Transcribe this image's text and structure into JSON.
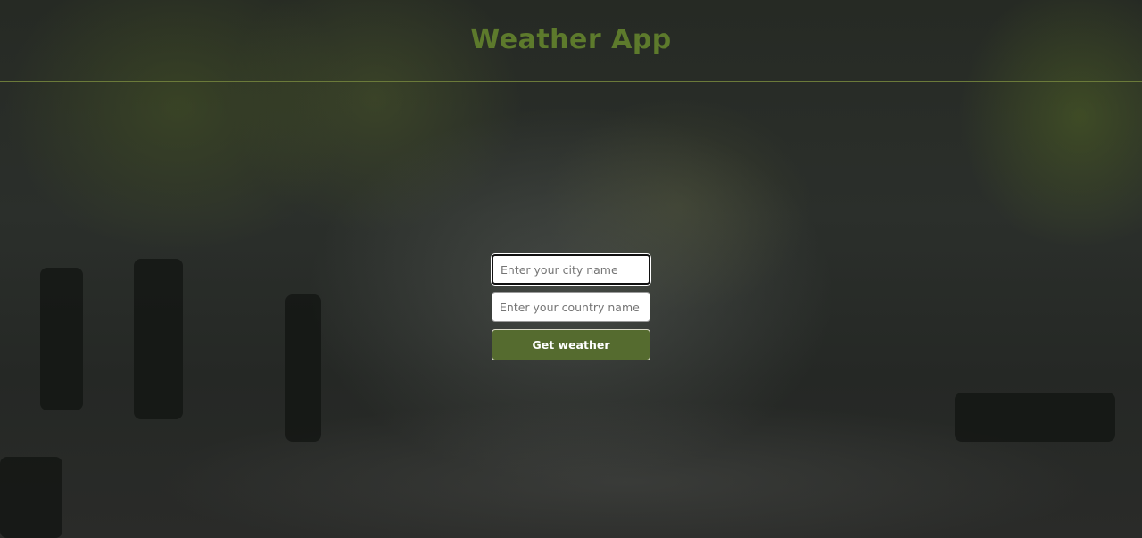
{
  "app": {
    "title": "Weather App"
  },
  "form": {
    "city": {
      "placeholder": "Enter your city name",
      "value": ""
    },
    "country": {
      "placeholder": "Enter your country name",
      "value": ""
    },
    "submit_label": "Get weather"
  },
  "colors": {
    "accent": "#556b2f",
    "title": "#5d7a2c",
    "divider": "#6b7a3a",
    "button_text": "#ffffff"
  }
}
